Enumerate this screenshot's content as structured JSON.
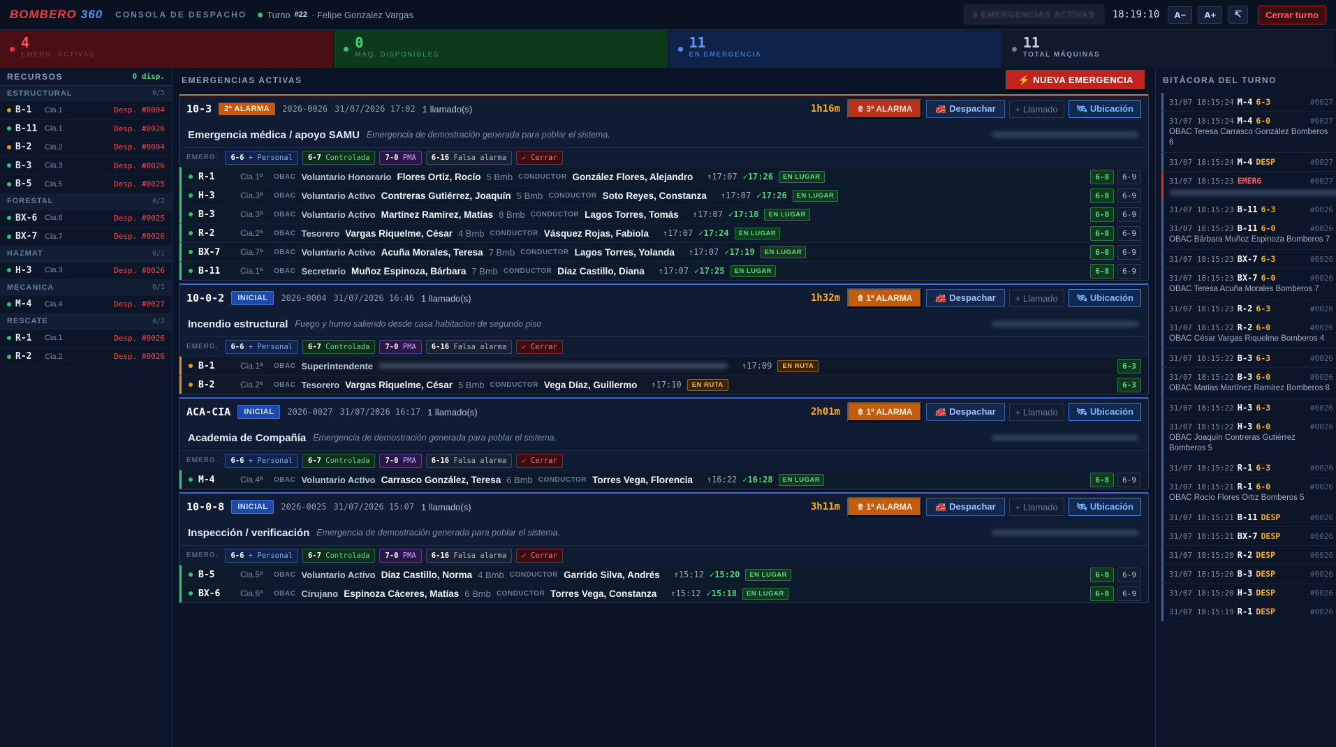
{
  "header": {
    "brand_1": "BOMBERO",
    "brand_2": "360",
    "console": "CONSOLA DE DESPACHO",
    "turno_label": "Turno",
    "turno_num": "#22",
    "turno_user": "· Felipe Gonzalez Vargas",
    "emerg_pill": "4 EMERGENCIAS ACTIVAS",
    "clock": "18:19:10",
    "font_minus": "A−",
    "font_plus": "A+",
    "expand_icon": "↸",
    "close_shift": "Cerrar turno"
  },
  "stats": [
    {
      "value": "4",
      "label": "EMERG. ACTIVAS"
    },
    {
      "value": "0",
      "label": "MÁQ. DISPONIBLES"
    },
    {
      "value": "11",
      "label": "EN EMERGENCIA"
    },
    {
      "value": "11",
      "label": "TOTAL MÁQUINAS"
    }
  ],
  "sidebar": {
    "title": "RECURSOS",
    "disp": "0 disp.",
    "groups": [
      {
        "name": "ESTRUCTURAL",
        "count": "0/5",
        "units": [
          {
            "name": "B-1",
            "cia": "Cia.1",
            "status": "Desp. #0004",
            "color": "#e39a2b"
          },
          {
            "name": "B-11",
            "cia": "Cia.1",
            "status": "Desp. #0026",
            "color": "#2fc76b"
          },
          {
            "name": "B-2",
            "cia": "Cia.2",
            "status": "Desp. #0004",
            "color": "#e39a2b"
          },
          {
            "name": "B-3",
            "cia": "Cia.3",
            "status": "Desp. #0026",
            "color": "#2fc76b"
          },
          {
            "name": "B-5",
            "cia": "Cia.5",
            "status": "Desp. #0025",
            "color": "#2fc76b"
          }
        ]
      },
      {
        "name": "FORESTAL",
        "count": "0/2",
        "units": [
          {
            "name": "BX-6",
            "cia": "Cia.6",
            "status": "Desp. #0025",
            "color": "#2fc76b"
          },
          {
            "name": "BX-7",
            "cia": "Cia.7",
            "status": "Desp. #0026",
            "color": "#2fc76b"
          }
        ]
      },
      {
        "name": "HAZMAT",
        "count": "0/1",
        "units": [
          {
            "name": "H-3",
            "cia": "Cia.3",
            "status": "Desp. #0026",
            "color": "#2fc76b"
          }
        ]
      },
      {
        "name": "MECANICA",
        "count": "0/1",
        "units": [
          {
            "name": "M-4",
            "cia": "Cia.4",
            "status": "Desp. #0027",
            "color": "#2fc76b"
          }
        ]
      },
      {
        "name": "RESCATE",
        "count": "0/2",
        "units": [
          {
            "name": "R-1",
            "cia": "Cia.1",
            "status": "Desp. #0026",
            "color": "#2fc76b"
          },
          {
            "name": "R-2",
            "cia": "Cia.2",
            "status": "Desp. #0026",
            "color": "#2fc76b"
          }
        ]
      }
    ]
  },
  "main": {
    "title": "EMERGENCIAS ACTIVAS",
    "new_button": "⚡ NUEVA EMERGENCIA",
    "chips": {
      "label": "EMERG.",
      "c1a": "6-6",
      "c1b": "+ Personal",
      "c2a": "6-7",
      "c2b": "Controlada",
      "c3a": "7-0",
      "c3b": "PMA",
      "c4a": "6-16",
      "c4b": "Falsa alarma",
      "c5": "✓ Cerrar"
    },
    "buttons": {
      "dispatch": "🚒 Despachar",
      "call": "+ Llamado",
      "location": "🛰 Ubicación"
    },
    "emergencies": [
      {
        "code": "10-3",
        "badge": "2ª ALARMA",
        "badge_kind": "alarma",
        "num": "2026-0026",
        "date": "31/07/2026 17:02",
        "calls": "1 llamado(s)",
        "elapsed": "1h16m",
        "alarm_btn": "⤊ 3ª ALARMA",
        "alarm_kind": "red",
        "type": "Emergencia médica / apoyo SAMU",
        "desc": "Emergencia de demostración generada para poblar el sistema.",
        "units": [
          {
            "name": "R-1",
            "cia": "Cia.1ª",
            "rank": "Voluntario Honorario",
            "person": "Flores Ortiz, Rocío",
            "bmb": "5 Bmb",
            "driver": "González Flores, Alejandro",
            "t1": "↑17:07",
            "t2": "✓17:26",
            "state": "EN LUGAR",
            "mode": "on",
            "acts": [
              "6-8",
              "6-9"
            ]
          },
          {
            "name": "H-3",
            "cia": "Cia.3ª",
            "rank": "Voluntario Activo",
            "person": "Contreras Gutiérrez, Joaquín",
            "bmb": "5 Bmb",
            "driver": "Soto Reyes, Constanza",
            "t1": "↑17:07",
            "t2": "✓17:26",
            "state": "EN LUGAR",
            "mode": "on",
            "acts": [
              "6-8",
              "6-9"
            ]
          },
          {
            "name": "B-3",
            "cia": "Cia.3ª",
            "rank": "Voluntario Activo",
            "person": "Martínez Ramírez, Matías",
            "bmb": "8 Bmb",
            "driver": "Lagos Torres, Tomás",
            "t1": "↑17:07",
            "t2": "✓17:18",
            "state": "EN LUGAR",
            "mode": "on",
            "acts": [
              "6-8",
              "6-9"
            ]
          },
          {
            "name": "R-2",
            "cia": "Cia.2ª",
            "rank": "Tesorero",
            "person": "Vargas Riquelme, César",
            "bmb": "4 Bmb",
            "driver": "Vásquez Rojas, Fabiola",
            "t1": "↑17:07",
            "t2": "✓17:24",
            "state": "EN LUGAR",
            "mode": "on",
            "acts": [
              "6-8",
              "6-9"
            ]
          },
          {
            "name": "BX-7",
            "cia": "Cia.7ª",
            "rank": "Voluntario Activo",
            "person": "Acuña Morales, Teresa",
            "bmb": "7 Bmb",
            "driver": "Lagos Torres, Yolanda",
            "t1": "↑17:07",
            "t2": "✓17:19",
            "state": "EN LUGAR",
            "mode": "on",
            "acts": [
              "6-8",
              "6-9"
            ]
          },
          {
            "name": "B-11",
            "cia": "Cia.1ª",
            "rank": "Secretario",
            "person": "Muñoz Espinoza, Bárbara",
            "bmb": "7 Bmb",
            "driver": "Díaz Castillo, Diana",
            "t1": "↑17:07",
            "t2": "✓17:25",
            "state": "EN LUGAR",
            "mode": "on",
            "acts": [
              "6-8",
              "6-9"
            ]
          }
        ]
      },
      {
        "code": "10-0-2",
        "badge": "INICIAL",
        "badge_kind": "inicial",
        "num": "2026-0004",
        "date": "31/07/2026 16:46",
        "calls": "1 llamado(s)",
        "elapsed": "1h32m",
        "alarm_btn": "⤊ 1ª ALARMA",
        "alarm_kind": "orange",
        "type": "Incendio estructural",
        "desc": "Fuego y humo saliendo desde casa habitacion de segundo piso",
        "units": [
          {
            "name": "B-1",
            "cia": "Cia.1ª",
            "rank": "Superintendente",
            "person": "",
            "bmb": "",
            "driver": "",
            "t1": "↑17:09",
            "t2": "",
            "state": "EN RUTA",
            "mode": "route",
            "blurred": true,
            "acts": [
              "6-3"
            ]
          },
          {
            "name": "B-2",
            "cia": "Cia.2ª",
            "rank": "Tesorero",
            "person": "Vargas Riquelme, César",
            "bmb": "5 Bmb",
            "driver": "Vega Díaz, Guillermo",
            "t1": "↑17:10",
            "t2": "",
            "state": "EN RUTA",
            "mode": "route",
            "acts": [
              "6-3"
            ]
          }
        ]
      },
      {
        "code": "ACA-CIA",
        "badge": "INICIAL",
        "badge_kind": "inicial",
        "num": "2026-0027",
        "date": "31/07/2026 16:17",
        "calls": "1 llamado(s)",
        "elapsed": "2h01m",
        "alarm_btn": "⤊ 1ª ALARMA",
        "alarm_kind": "orange",
        "type": "Academia de Compañía",
        "desc": "Emergencia de demostración generada para poblar el sistema.",
        "units": [
          {
            "name": "M-4",
            "cia": "Cia.4ª",
            "rank": "Voluntario Activo",
            "person": "Carrasco González, Teresa",
            "bmb": "6 Bmb",
            "driver": "Torres Vega, Florencia",
            "t1": "↑16:22",
            "t2": "✓16:28",
            "state": "EN LUGAR",
            "mode": "on",
            "acts": [
              "6-8",
              "6-9"
            ]
          }
        ]
      },
      {
        "code": "10-0-8",
        "badge": "INICIAL",
        "badge_kind": "inicial",
        "num": "2026-0025",
        "date": "31/07/2026 15:07",
        "calls": "1 llamado(s)",
        "elapsed": "3h11m",
        "alarm_btn": "⤊ 1ª ALARMA",
        "alarm_kind": "orange",
        "type": "Inspección / verificación",
        "desc": "Emergencia de demostración generada para poblar el sistema.",
        "units": [
          {
            "name": "B-5",
            "cia": "Cia.5ª",
            "rank": "Voluntario Activo",
            "person": "Díaz Castillo, Norma",
            "bmb": "4 Bmb",
            "driver": "Garrido Silva, Andrés",
            "t1": "↑15:12",
            "t2": "✓15:20",
            "state": "EN LUGAR",
            "mode": "on",
            "acts": [
              "6-8",
              "6-9"
            ]
          },
          {
            "name": "BX-6",
            "cia": "Cia.6ª",
            "rank": "Cirujano",
            "person": "Espinoza Cáceres, Matías",
            "bmb": "6 Bmb",
            "driver": "Torres Vega, Constanza",
            "t1": "↑15:12",
            "t2": "✓15:18",
            "state": "EN LUGAR",
            "mode": "on",
            "acts": [
              "6-8",
              "6-9"
            ]
          }
        ]
      }
    ],
    "obac": "OBAC",
    "conductor": "CONDUCTOR"
  },
  "log": {
    "title": "BITÁCORA DEL TURNO",
    "entries": [
      {
        "ts": "31/07 18:15:24",
        "unit": "M-4",
        "ev": "6-3",
        "ref": "#0027"
      },
      {
        "ts": "31/07 18:15:24",
        "unit": "M-4",
        "ev": "6-0",
        "ref": "#0027",
        "det": "OBAC Teresa Carrasco González Bomberos 6"
      },
      {
        "ts": "31/07 18:15:24",
        "unit": "M-4",
        "ev": "DESP",
        "ref": "#0027"
      },
      {
        "ts": "31/07 18:15:23",
        "unit": "",
        "ev": "EMERG",
        "ref": "#0027",
        "red": true,
        "blur": true
      },
      {
        "ts": "31/07 18:15:23",
        "unit": "B-11",
        "ev": "6-3",
        "ref": "#0026"
      },
      {
        "ts": "31/07 18:15:23",
        "unit": "B-11",
        "ev": "6-0",
        "ref": "#0026",
        "det": "OBAC Bárbara Muñoz Espinoza Bomberos 7"
      },
      {
        "ts": "31/07 18:15:23",
        "unit": "BX-7",
        "ev": "6-3",
        "ref": "#0026"
      },
      {
        "ts": "31/07 18:15:23",
        "unit": "BX-7",
        "ev": "6-0",
        "ref": "#0026",
        "det": "OBAC Teresa Acuña Morales Bomberos 7"
      },
      {
        "ts": "31/07 18:15:23",
        "unit": "R-2",
        "ev": "6-3",
        "ref": "#0026"
      },
      {
        "ts": "31/07 18:15:22",
        "unit": "R-2",
        "ev": "6-0",
        "ref": "#0026",
        "det": "OBAC César Vargas Riquelme Bomberos 4"
      },
      {
        "ts": "31/07 18:15:22",
        "unit": "B-3",
        "ev": "6-3",
        "ref": "#0026"
      },
      {
        "ts": "31/07 18:15:22",
        "unit": "B-3",
        "ev": "6-0",
        "ref": "#0026",
        "det": "OBAC Matías Martínez Ramírez Bomberos 8"
      },
      {
        "ts": "31/07 18:15:22",
        "unit": "H-3",
        "ev": "6-3",
        "ref": "#0026"
      },
      {
        "ts": "31/07 18:15:22",
        "unit": "H-3",
        "ev": "6-0",
        "ref": "#0026",
        "det": "OBAC Joaquín Contreras Gutiérrez Bomberos 5"
      },
      {
        "ts": "31/07 18:15:22",
        "unit": "R-1",
        "ev": "6-3",
        "ref": "#0026"
      },
      {
        "ts": "31/07 18:15:21",
        "unit": "R-1",
        "ev": "6-0",
        "ref": "#0026",
        "det": "OBAC Rocío Flores Ortiz Bomberos 5"
      },
      {
        "ts": "31/07 18:15:21",
        "unit": "B-11",
        "ev": "DESP",
        "ref": "#0026"
      },
      {
        "ts": "31/07 18:15:21",
        "unit": "BX-7",
        "ev": "DESP",
        "ref": "#0026"
      },
      {
        "ts": "31/07 18:15:20",
        "unit": "R-2",
        "ev": "DESP",
        "ref": "#0026"
      },
      {
        "ts": "31/07 18:15:20",
        "unit": "B-3",
        "ev": "DESP",
        "ref": "#0026"
      },
      {
        "ts": "31/07 18:15:20",
        "unit": "H-3",
        "ev": "DESP",
        "ref": "#0026"
      },
      {
        "ts": "31/07 18:15:19",
        "unit": "R-1",
        "ev": "DESP",
        "ref": "#0026"
      }
    ]
  }
}
